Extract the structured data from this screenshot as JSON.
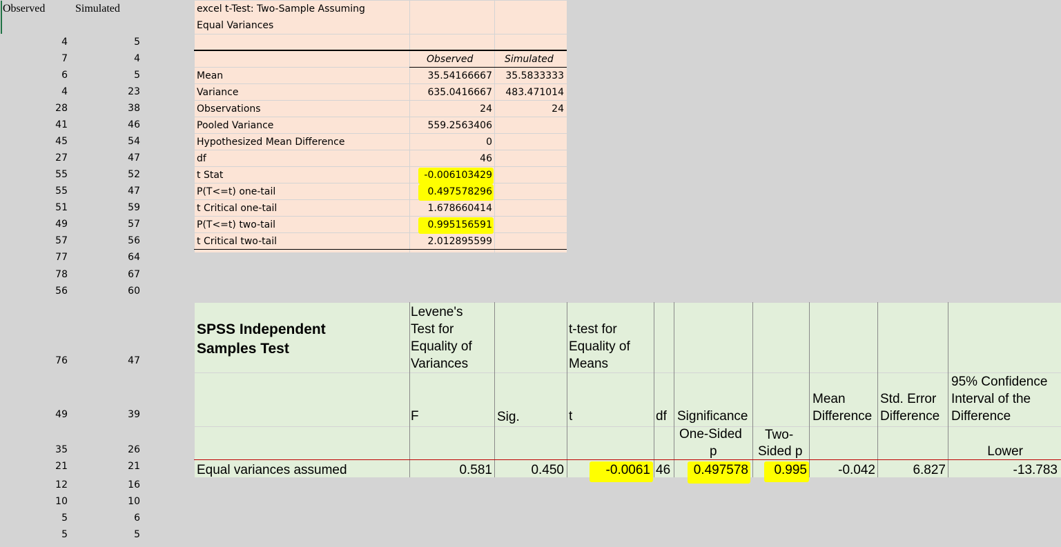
{
  "columns": {
    "a_header": "Observed",
    "b_header": "Simulated"
  },
  "data_rows": [
    {
      "obs": "4",
      "sim": "5"
    },
    {
      "obs": "7",
      "sim": "4"
    },
    {
      "obs": "6",
      "sim": "5"
    },
    {
      "obs": "4",
      "sim": "23"
    },
    {
      "obs": "28",
      "sim": "38"
    },
    {
      "obs": "41",
      "sim": "46"
    },
    {
      "obs": "45",
      "sim": "54"
    },
    {
      "obs": "27",
      "sim": "47"
    },
    {
      "obs": "55",
      "sim": "52"
    },
    {
      "obs": "55",
      "sim": "47"
    },
    {
      "obs": "51",
      "sim": "59"
    },
    {
      "obs": "49",
      "sim": "57"
    },
    {
      "obs": "57",
      "sim": "56"
    },
    {
      "obs": "77",
      "sim": "64"
    },
    {
      "obs": "78",
      "sim": "67"
    },
    {
      "obs": "56",
      "sim": "60"
    },
    {
      "obs": "76",
      "sim": "47"
    },
    {
      "obs": "49",
      "sim": "39"
    },
    {
      "obs": "35",
      "sim": "26"
    },
    {
      "obs": "21",
      "sim": "21"
    },
    {
      "obs": "12",
      "sim": "16"
    },
    {
      "obs": "10",
      "sim": "10"
    },
    {
      "obs": "5",
      "sim": "6"
    },
    {
      "obs": "5",
      "sim": "5"
    }
  ],
  "excel_ttest": {
    "title_line1": "excel t-Test: Two-Sample Assuming",
    "title_line2": "Equal Variances",
    "col_observed": "Observed",
    "col_simulated": "Simulated",
    "rows": [
      {
        "label": "Mean",
        "obs": "35.54166667",
        "sim": "35.5833333"
      },
      {
        "label": "Variance",
        "obs": "635.0416667",
        "sim": "483.471014"
      },
      {
        "label": "Observations",
        "obs": "24",
        "sim": "24"
      },
      {
        "label": "Pooled Variance",
        "obs": "559.2563406",
        "sim": ""
      },
      {
        "label": "Hypothesized Mean Difference",
        "obs": "0",
        "sim": ""
      },
      {
        "label": "df",
        "obs": "46",
        "sim": ""
      },
      {
        "label": "t Stat",
        "obs": "-0.006103429",
        "sim": "",
        "highlight": true
      },
      {
        "label": "P(T<=t) one-tail",
        "obs": "0.497578296",
        "sim": "",
        "highlight": true
      },
      {
        "label": "t Critical one-tail",
        "obs": "1.678660414",
        "sim": ""
      },
      {
        "label": "P(T<=t) two-tail",
        "obs": "0.995156591",
        "sim": "",
        "highlight": true
      },
      {
        "label": "t Critical two-tail",
        "obs": "2.012895599",
        "sim": ""
      }
    ]
  },
  "spss": {
    "title_line1": "SPSS Independent",
    "title_line2": "Samples Test",
    "levene_line1": "Levene's",
    "levene_line2": "Test for",
    "levene_line3": "Equality of",
    "levene_line4": "Variances",
    "ttest_line1": "t-test for",
    "ttest_line2": "Equality of",
    "ttest_line3": "Means",
    "h_f": "F",
    "h_sig": "Sig.",
    "h_t": "t",
    "h_df": "df",
    "h_sig1_line1": "Significance",
    "h_sig1_line2": "One-Sided",
    "h_sig1_line3": "p",
    "h_sig2_line1": "Two-",
    "h_sig2_line2": "Sided p",
    "h_md_line1": "Mean",
    "h_md_line2": "Difference",
    "h_se_line1": "Std. Error",
    "h_se_line2": "Difference",
    "h_ci_line1": "95% Confidence",
    "h_ci_line2": "Interval of the",
    "h_ci_line3": "Difference",
    "h_ci_line4": "Lower",
    "row_label": "Equal variances assumed",
    "v_f": "0.581",
    "v_sig": "0.450",
    "v_t": "-0.0061",
    "v_df": "46",
    "v_sig1": "0.497578",
    "v_sig2": "0.995",
    "v_md": "-0.042",
    "v_se": "6.827",
    "v_lower": "-13.783"
  },
  "colors": {
    "peach": "#fce4d6",
    "green": "#e2efda",
    "highlight": "#ffff00",
    "grid": "#d4d4d4",
    "selection": "#217346"
  }
}
